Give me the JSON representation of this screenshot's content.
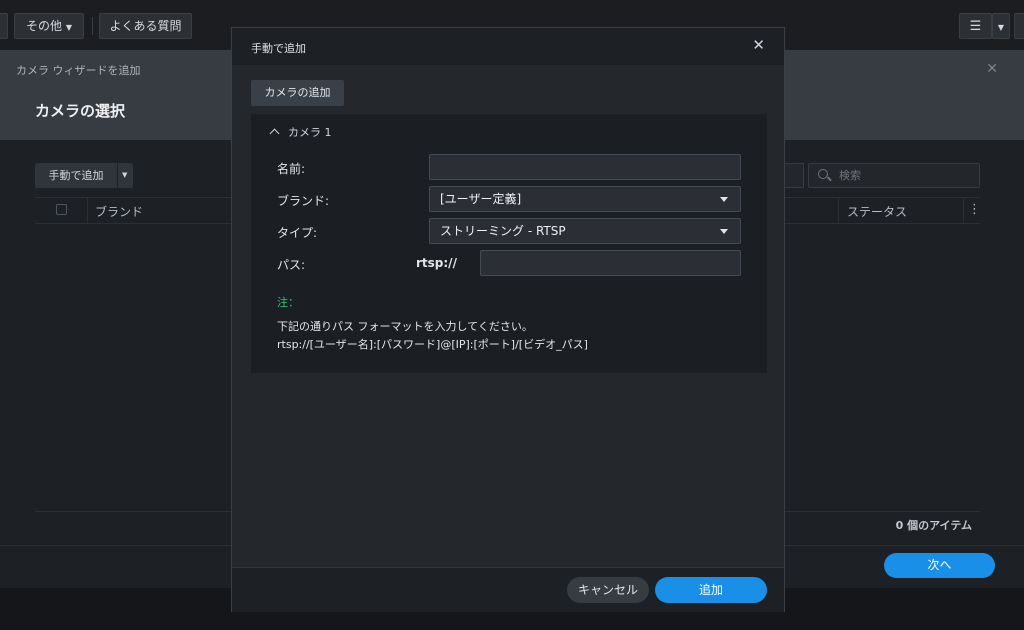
{
  "toolbar": {
    "other_label": "その他",
    "faq_label": "よくある質問"
  },
  "wizard": {
    "subtitle": "カメラ ウィザードを追加",
    "title": "カメラの選択",
    "add_manual_label": "手動で追加",
    "search_placeholder": "検索",
    "columns": [
      "ブランド",
      "ステータス"
    ],
    "item_count": "0 個のアイテム",
    "next_label": "次へ"
  },
  "modal": {
    "title": "手動で追加",
    "add_camera_label": "カメラの追加",
    "camera_section": "カメラ 1",
    "fields": {
      "name_label": "名前:",
      "brand_label": "ブランド:",
      "brand_value": "[ユーザー定義]",
      "type_label": "タイプ:",
      "type_value": "ストリーミング - RTSP",
      "path_label": "パス:",
      "path_prefix": "rtsp://"
    },
    "note_label": "注：",
    "note_line1": "下記の通りパス フォーマットを入力してください。",
    "note_line2": "rtsp://[ユーザー名]:[パスワード]@[IP]:[ポート]/[ビデオ_パス]",
    "cancel_label": "キャンセル",
    "ok_label": "追加"
  },
  "colors": {
    "accent": "#1a8fe8",
    "note": "#35c07a"
  }
}
